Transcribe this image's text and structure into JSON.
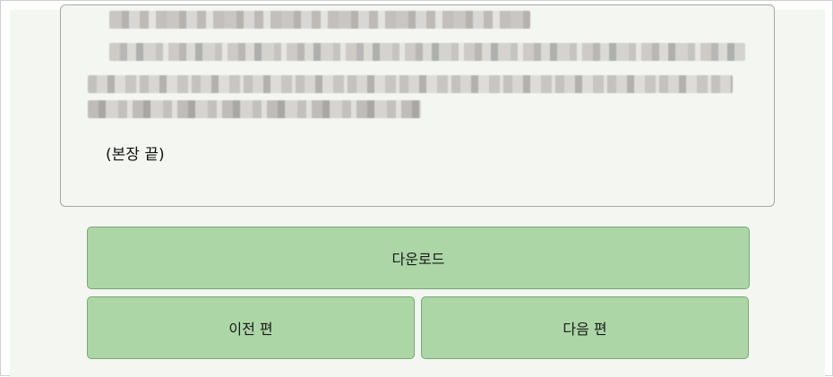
{
  "content": {
    "end_marker": "(본장 끝)"
  },
  "actions": {
    "download_label": "다운로드",
    "prev_label": "이전 편",
    "next_label": "다음 편"
  },
  "colors": {
    "page_background": "#f4f6f1",
    "button_fill": "#acd6a6",
    "button_border": "#7ba777",
    "card_border": "#a6aaa4"
  }
}
